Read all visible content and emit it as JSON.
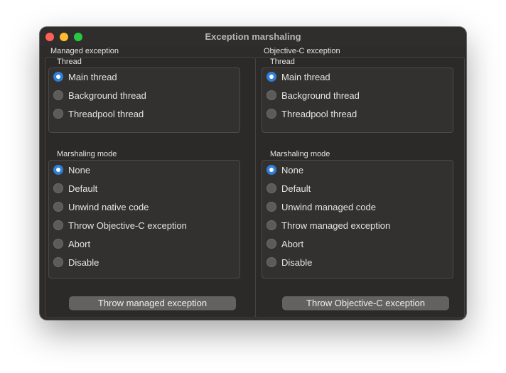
{
  "window": {
    "title": "Exception marshaling",
    "traffic_colors": {
      "close": "#fe5f57",
      "minimize": "#febc2e",
      "zoom": "#28c840"
    }
  },
  "left": {
    "title": "Managed exception",
    "thread": {
      "title": "Thread",
      "options": [
        "Main thread",
        "Background thread",
        "Threadpool thread"
      ],
      "selected": "Main thread"
    },
    "marshaling": {
      "title": "Marshaling mode",
      "options": [
        "None",
        "Default",
        "Unwind native code",
        "Throw Objective-C exception",
        "Abort",
        "Disable"
      ],
      "selected": "None"
    },
    "button_label": "Throw managed exception"
  },
  "right": {
    "title": "Objective-C exception",
    "thread": {
      "title": "Thread",
      "options": [
        "Main thread",
        "Background thread",
        "Threadpool thread"
      ],
      "selected": "Main thread"
    },
    "marshaling": {
      "title": "Marshaling mode",
      "options": [
        "None",
        "Default",
        "Unwind managed code",
        "Throw managed exception",
        "Abort",
        "Disable"
      ],
      "selected": "None"
    },
    "button_label": "Throw Objective-C exception"
  },
  "colors": {
    "accent": "#2f7fd6",
    "window_bg": "#2d2c2b"
  }
}
